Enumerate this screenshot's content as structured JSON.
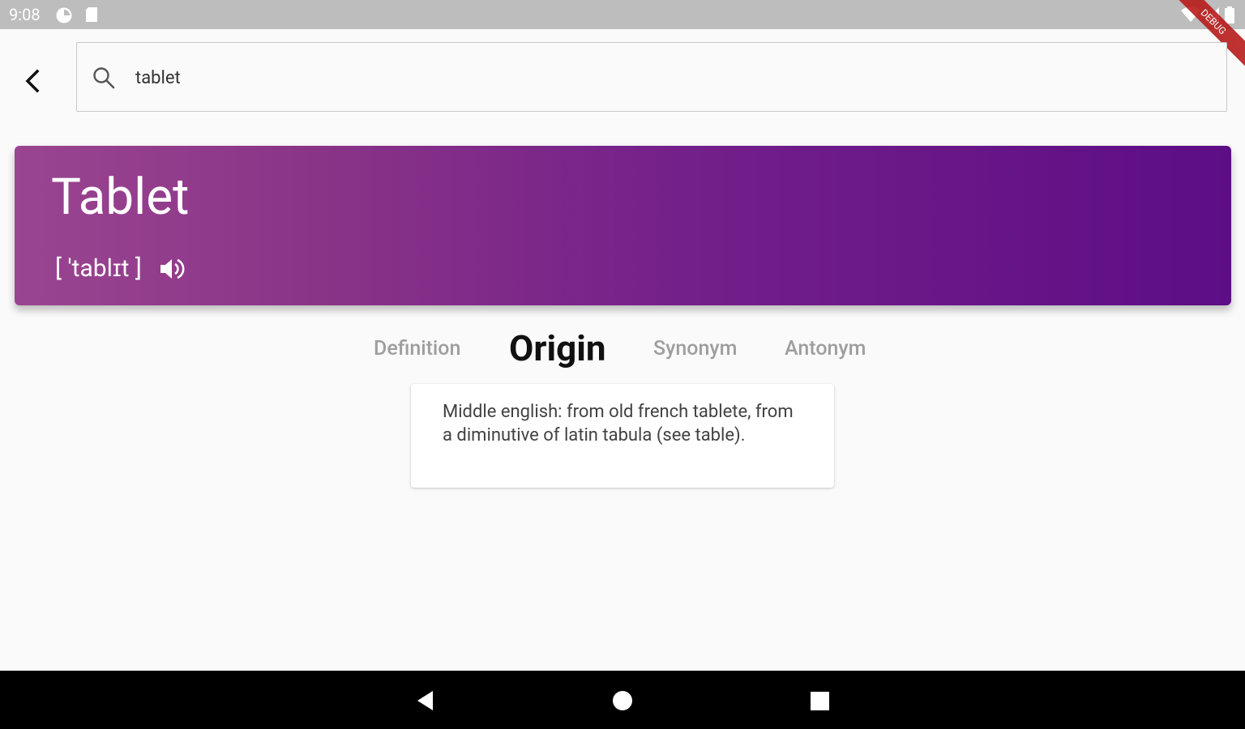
{
  "status_bar": {
    "time": "9:08",
    "debug_label": "DEBUG",
    "icons": [
      "data-saver-icon",
      "sd-card-icon",
      "wifi-icon",
      "signal-icon",
      "battery-icon"
    ]
  },
  "search": {
    "value": "tablet",
    "placeholder": "Search"
  },
  "word": {
    "title": "Tablet",
    "pronunciation": "[ 'tablɪt ]"
  },
  "tabs": [
    {
      "label": "Definition",
      "active": false
    },
    {
      "label": "Origin",
      "active": true
    },
    {
      "label": "Synonym",
      "active": false
    },
    {
      "label": "Antonym",
      "active": false
    }
  ],
  "content": {
    "text": "Middle english: from old french tablete, from a diminutive of latin tabula (see table)."
  },
  "colors": {
    "gradient_start": "#9a4590",
    "gradient_end": "#5d0d86",
    "active_tab": "#111111",
    "inactive_tab": "#9e9e9e"
  }
}
